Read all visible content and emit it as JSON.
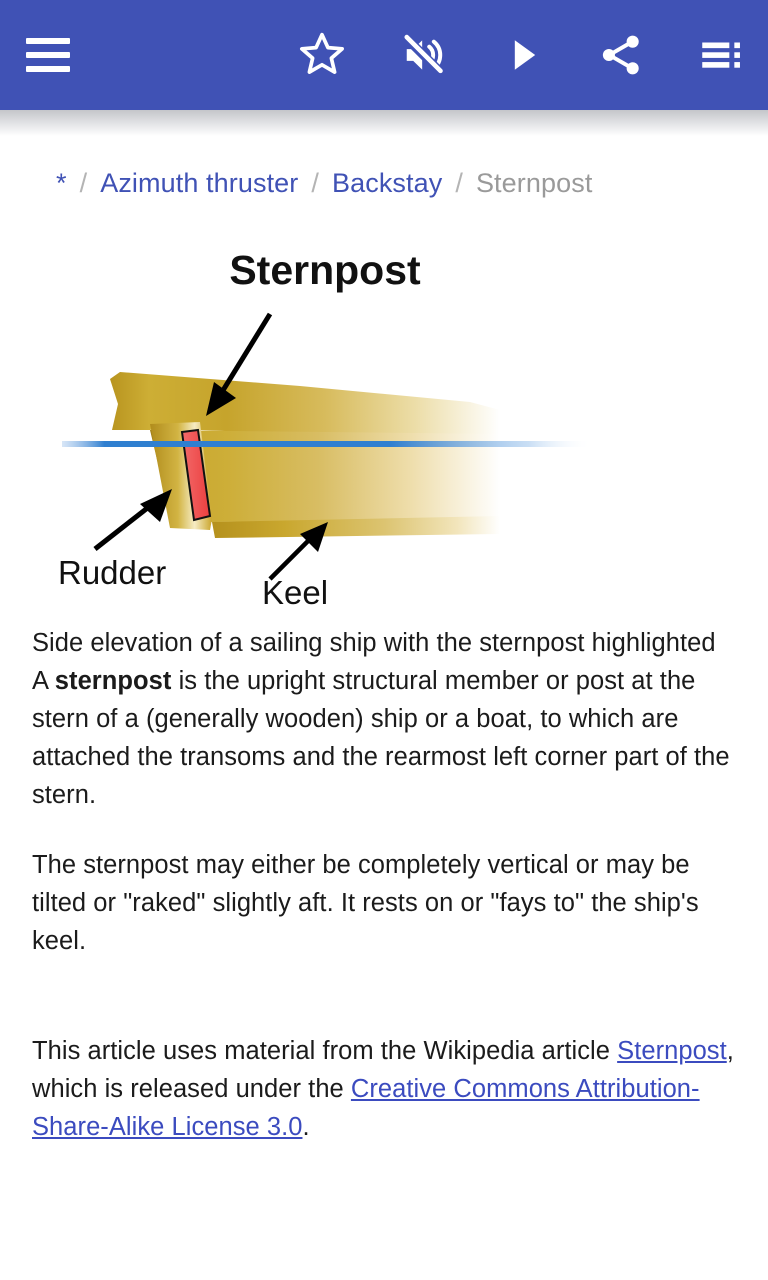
{
  "appbar": {
    "background": "#4052b5",
    "icons": [
      {
        "name": "menu-icon",
        "label": "Menu"
      },
      {
        "name": "star-outline-icon",
        "label": "Favorite"
      },
      {
        "name": "volume-off-icon",
        "label": "Mute"
      },
      {
        "name": "play-icon",
        "label": "Play"
      },
      {
        "name": "share-icon",
        "label": "Share"
      },
      {
        "name": "list-menu-icon",
        "label": "Table of contents"
      }
    ]
  },
  "breadcrumb": {
    "home": "*",
    "separator": "/",
    "items": [
      {
        "label": "Azimuth thruster",
        "current": false
      },
      {
        "label": "Backstay",
        "current": false
      },
      {
        "label": "Sternpost",
        "current": true
      }
    ],
    "link_color": "#4052b5",
    "current_color": "#9a9a9a"
  },
  "figure": {
    "alt": "Side elevation of a sailing ship with the sternpost highlighted",
    "title_label": "Sternpost",
    "labels": [
      {
        "name": "sternpost-label",
        "text": "Sternpost"
      },
      {
        "name": "rudder-label",
        "text": "Rudder"
      },
      {
        "name": "keel-label",
        "text": "Keel"
      }
    ],
    "colors": {
      "hull_light": "#e8d79b",
      "hull_mid": "#c9a227",
      "hull_dark": "#a8861b",
      "highlight": "#f15b5b",
      "highlight_stroke": "#000000",
      "waterline": "#2f7fd0"
    }
  },
  "article": {
    "caption": "Side elevation of a sailing ship with the sternpost highlighted",
    "lead_prefix": "A ",
    "lead_bold": "sternpost",
    "lead_rest": " is the upright structural member or post at the stern of a (generally wooden) ship or a boat, to which are attached the transoms and the rearmost left corner part of the stern.",
    "paragraph_2": "The sternpost may either be completely vertical or may be tilted or \"raked\" slightly aft. It rests on or \"fays to\" the ship's keel.",
    "attribution": {
      "prefix": "This article uses material from the Wikipedia article ",
      "link_article": "Sternpost",
      "middle": ", which is released under the ",
      "link_license": "Creative Commons Attribution-Share-Alike License 3.0",
      "suffix": ".",
      "link_color": "#3b4bbf"
    }
  }
}
